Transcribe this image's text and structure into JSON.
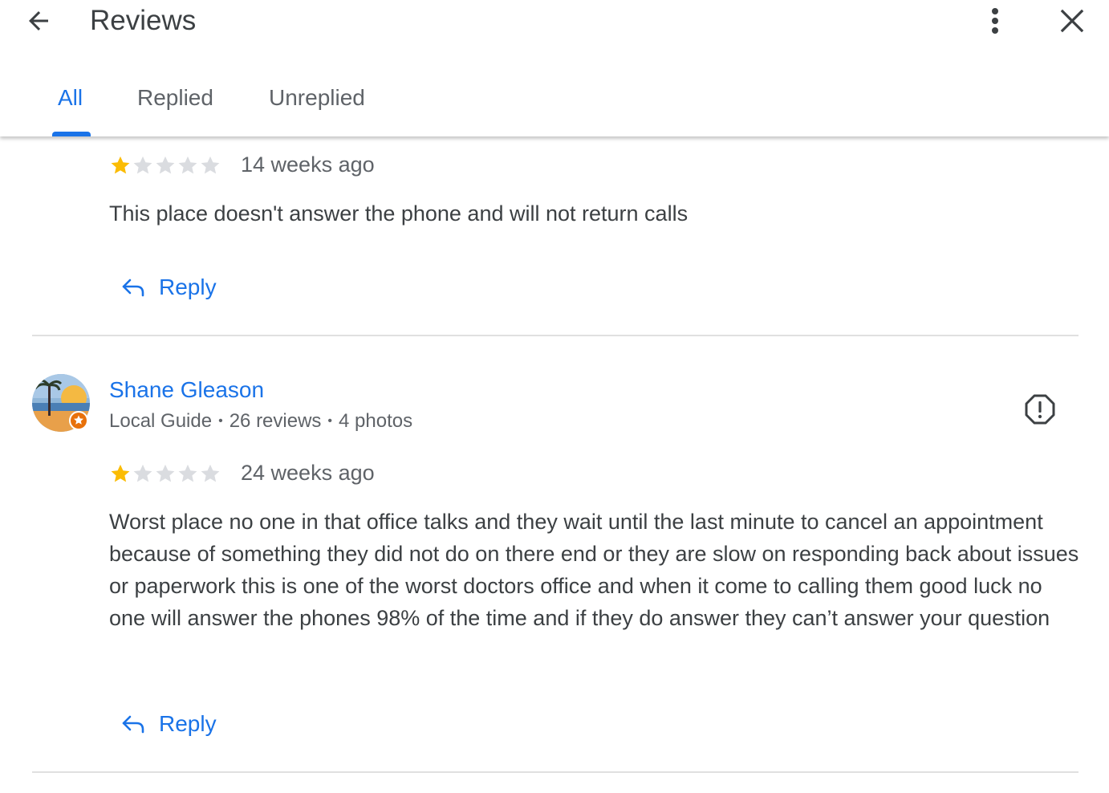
{
  "header": {
    "title": "Reviews",
    "tabs": [
      {
        "label": "All",
        "active": true
      },
      {
        "label": "Replied",
        "active": false
      },
      {
        "label": "Unreplied",
        "active": false
      }
    ]
  },
  "colors": {
    "accent": "#1a73e8",
    "star_filled": "#fbbc04",
    "star_empty": "#dadce0",
    "text": "#3c4043",
    "secondary_text": "#5f6368"
  },
  "reviews": [
    {
      "rating": 1,
      "max_rating": 5,
      "time": "14 weeks ago",
      "text": "This place doesn't answer the phone and will not return calls",
      "reply_label": "Reply"
    },
    {
      "reviewer": {
        "name": "Shane Gleason",
        "badge": "Local Guide",
        "reviews_count": "26 reviews",
        "photos_count": "4 photos"
      },
      "rating": 1,
      "max_rating": 5,
      "time": "24 weeks ago",
      "text": "Worst place no one in that office talks and they wait until the last minute to cancel an appointment because of something they did not do on there end or they are slow on responding back about issues or paperwork this is one of the worst doctors office and when it come to calling them good luck no one will answer the phones 98% of the time and if they do answer they can’t answer your question",
      "reply_label": "Reply"
    }
  ],
  "icons": {
    "back": "arrow-back-icon",
    "more": "more-vert-icon",
    "close": "close-icon",
    "reply": "reply-arrow-icon",
    "flag": "report-flag-icon",
    "star": "star-icon"
  }
}
